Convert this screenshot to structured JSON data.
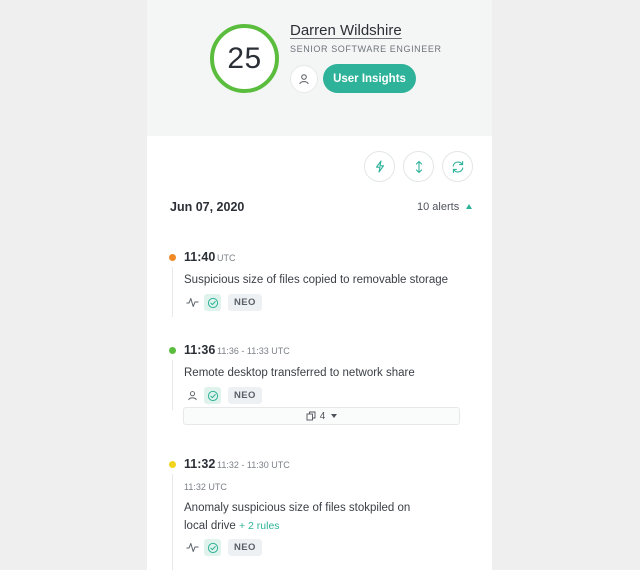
{
  "profile": {
    "score": "25",
    "name": "Darren Wildshire",
    "role": "SENIOR SOFTWARE ENGINEER",
    "insights_label": "User Insights"
  },
  "toolbar": {
    "icons": [
      "bolt-icon",
      "expand-vertical-icon",
      "refresh-icon"
    ]
  },
  "timeline": {
    "date": "Jun 07, 2020",
    "alert_count": "10 alerts",
    "events": [
      {
        "time": "11:40",
        "time_suffix": "UTC",
        "title": "Suspicious size of files copied to removable storage",
        "severity_color": "#f08a24",
        "source_icon": "activity-icon",
        "tag": "NEO"
      },
      {
        "time": "11:36",
        "time_suffix": "11:36 - 11:33 UTC",
        "title": "Remote desktop transferred to network share",
        "severity_color": "#5bbd3d",
        "source_icon": "user-icon",
        "tag": "NEO",
        "group_count": "4"
      },
      {
        "time": "11:32",
        "time_suffix": "11:32 - 11:30 UTC",
        "sub_time": "11:32 UTC",
        "title_line1": "Anomaly suspicious size of files stokpiled on",
        "title_line2": "local drive",
        "rules": "+ 2 rules",
        "severity_color": "#f2d41c",
        "source_icon": "activity-icon",
        "tag": "NEO"
      }
    ]
  },
  "colors": {
    "accent": "#2eb299",
    "score_ring": "#5bbd3d",
    "background": "#efefef",
    "header_bg": "#f4f6f5"
  }
}
